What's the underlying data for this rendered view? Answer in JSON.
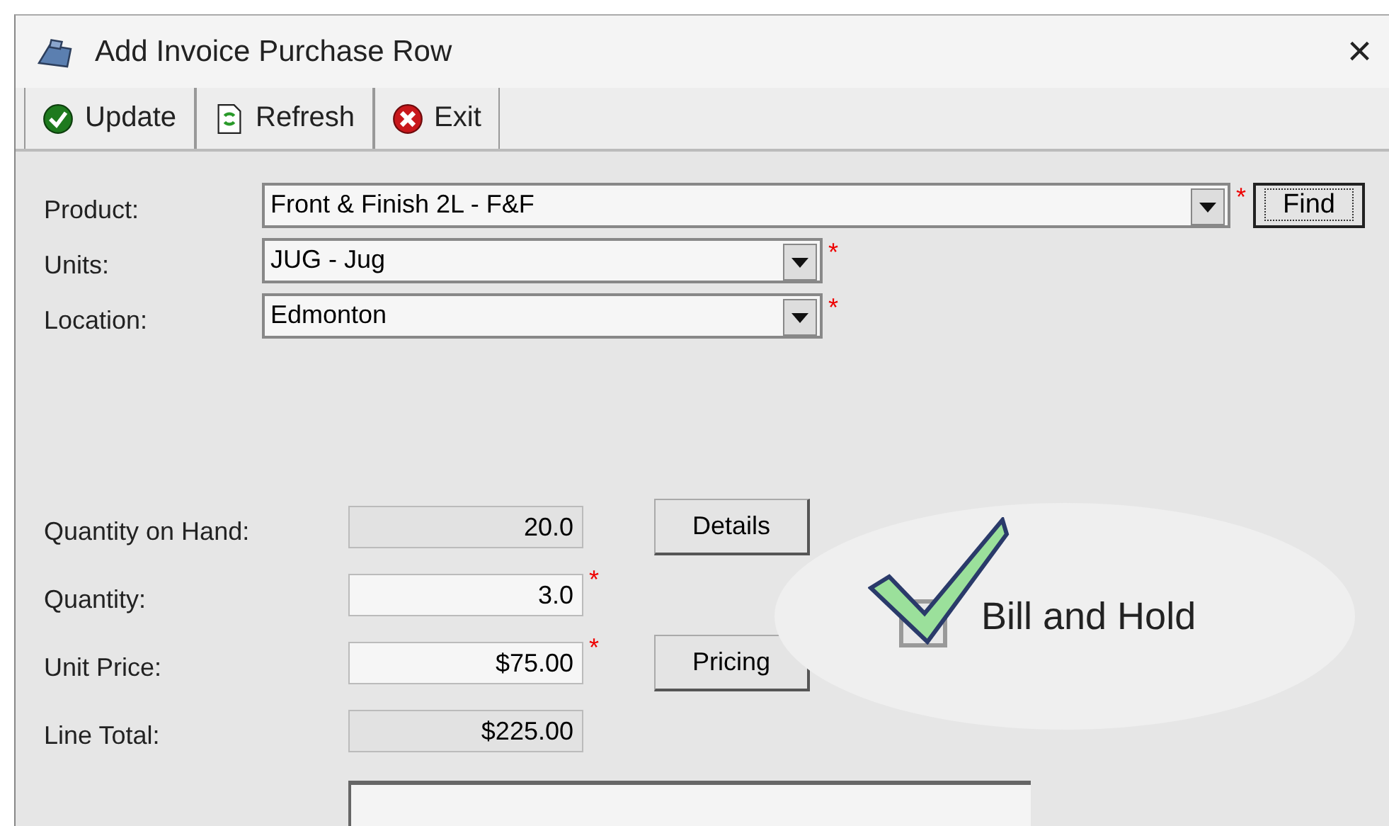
{
  "window": {
    "title": "Add Invoice Purchase Row",
    "close": "×"
  },
  "toolbar": [
    {
      "kind": "update",
      "label": "Update"
    },
    {
      "kind": "refresh",
      "label": "Refresh"
    },
    {
      "kind": "exit",
      "label": "Exit"
    }
  ],
  "combos": [
    {
      "label": "Product:",
      "value": "Front & Finish 2L - F&F",
      "required_mark": "*",
      "wide": true,
      "button": "Find"
    },
    {
      "label": "Units:",
      "value": "JUG - Jug",
      "required_mark": "*",
      "wide": false
    },
    {
      "label": "Location:",
      "value": "Edmonton",
      "required_mark": "*",
      "wide": false
    }
  ],
  "amounts": [
    {
      "label": "Quantity on Hand:",
      "value": "20.0",
      "readonly": true,
      "button": "Details"
    },
    {
      "label": "Quantity:",
      "value": "3.0",
      "readonly": false,
      "required_mark": "*"
    },
    {
      "label": "Unit Price:",
      "value": "$75.00",
      "readonly": false,
      "required_mark": "*",
      "button": "Pricing"
    },
    {
      "label": "Line Total:",
      "value": "$225.00",
      "readonly": true
    }
  ],
  "callout": {
    "label": "Bill and Hold",
    "checked": true
  }
}
